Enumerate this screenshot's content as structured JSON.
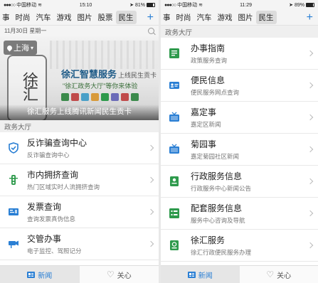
{
  "left": {
    "status": {
      "carrier": "中国移动",
      "time": "15:10",
      "battery": "81%",
      "battery_level": 0.81
    },
    "nav": {
      "tabs": [
        "事",
        "时尚",
        "汽车",
        "游戏",
        "图片",
        "股票",
        "民生"
      ],
      "active": "民生"
    },
    "date": "11月30日 星期一",
    "banner": {
      "location": "上海",
      "title": "徐汇智慧服务",
      "title_suffix": "上线民生贡卡",
      "subtitle": "\"徐汇政务大厅\"等你来体验",
      "calligraphy": "徐汇",
      "caption": "徐汇服务上线腾讯新闻民生贡卡"
    },
    "section": "政务大厅",
    "items": [
      {
        "title": "反诈骗查询中心",
        "subtitle": "反诈骗查询中心",
        "icon": "shield-icon"
      },
      {
        "title": "市内拥挤查询",
        "subtitle": "热门区域实时人流拥挤查询",
        "icon": "traffic-light-icon"
      },
      {
        "title": "发票查询",
        "subtitle": "查询发票真伪信息",
        "icon": "invoice-icon"
      },
      {
        "title": "交管办事",
        "subtitle": "电子监控、驾照记分",
        "icon": "camera-icon"
      }
    ],
    "tabbar": {
      "news": "新闻",
      "follow": "关心"
    }
  },
  "right": {
    "status": {
      "carrier": "中国移动",
      "time": "11:29",
      "battery": "89%",
      "battery_level": 0.89
    },
    "nav": {
      "tabs": [
        "事",
        "时尚",
        "汽车",
        "游戏",
        "图片",
        "民生"
      ],
      "active": "民生"
    },
    "section": "政务大厅",
    "items": [
      {
        "title": "办事指南",
        "subtitle": "政策服务查询",
        "icon": "guide-icon"
      },
      {
        "title": "便民信息",
        "subtitle": "便民服务网点查询",
        "icon": "id-card-icon"
      },
      {
        "title": "嘉定事",
        "subtitle": "嘉定区新闻",
        "icon": "tv-icon"
      },
      {
        "title": "菊园事",
        "subtitle": "嘉定菊园社区新闻",
        "icon": "tv-icon"
      },
      {
        "title": "行政服务信息",
        "subtitle": "行政服务中心新闻公告",
        "icon": "document-icon"
      },
      {
        "title": "配套服务信息",
        "subtitle": "服务中心咨询及导航",
        "icon": "list-icon"
      },
      {
        "title": "徐汇服务",
        "subtitle": "徐汇行政便民服务办理",
        "icon": "badge-icon"
      }
    ],
    "tabbar": {
      "news": "新闻",
      "follow": "关心"
    }
  },
  "colors": {
    "accent": "#2a7fd4",
    "icon_green": "#2e9a4c"
  }
}
